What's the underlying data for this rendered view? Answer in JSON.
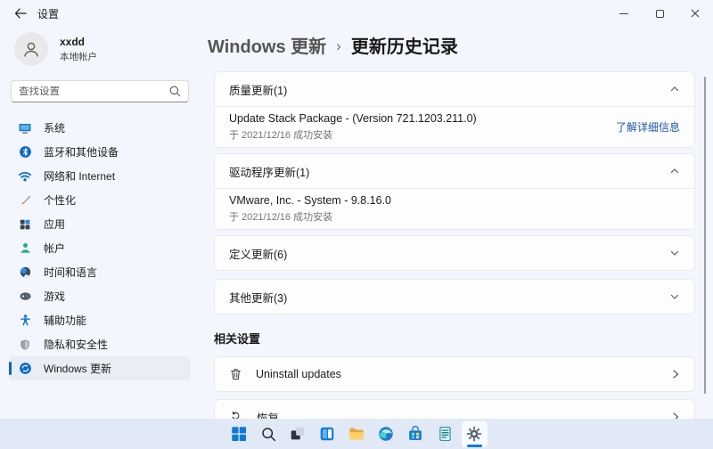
{
  "window": {
    "title": "设置"
  },
  "profile": {
    "name": "xxdd",
    "type": "本地帐户"
  },
  "search": {
    "placeholder": "查找设置"
  },
  "sidebar": {
    "items": [
      {
        "label": "系统",
        "icon": "system-icon"
      },
      {
        "label": "蓝牙和其他设备",
        "icon": "bluetooth-icon"
      },
      {
        "label": "网络和 Internet",
        "icon": "network-icon"
      },
      {
        "label": "个性化",
        "icon": "personalization-icon"
      },
      {
        "label": "应用",
        "icon": "apps-icon"
      },
      {
        "label": "帐户",
        "icon": "accounts-icon"
      },
      {
        "label": "时间和语言",
        "icon": "time-language-icon"
      },
      {
        "label": "游戏",
        "icon": "gaming-icon"
      },
      {
        "label": "辅助功能",
        "icon": "accessibility-icon"
      },
      {
        "label": "隐私和安全性",
        "icon": "privacy-icon"
      },
      {
        "label": "Windows 更新",
        "icon": "windows-update-icon"
      }
    ],
    "selected": "Windows 更新"
  },
  "header": {
    "breadcrumb_root": "Windows 更新",
    "separator": "›",
    "breadcrumb_current": "更新历史记录"
  },
  "sections": {
    "quality": {
      "label": "质量更新(1)",
      "expanded": true,
      "item_title": "Update Stack Package - (Version 721.1203.211.0)",
      "item_subtitle": "于 2021/12/16 成功安装",
      "item_link": "了解详细信息"
    },
    "driver": {
      "label": "驱动程序更新(1)",
      "expanded": true,
      "item_title": "VMware, Inc. - System - 9.8.16.0",
      "item_subtitle": "于 2021/12/16 成功安装"
    },
    "definition": {
      "label": "定义更新(6)",
      "expanded": false
    },
    "other": {
      "label": "其他更新(3)",
      "expanded": false
    }
  },
  "related": {
    "heading": "相关设置",
    "uninstall_label": "Uninstall updates",
    "recovery_label": "恢复"
  },
  "taskbar": {
    "icons": [
      "start",
      "search",
      "task-view",
      "widgets",
      "file-explorer",
      "edge",
      "store",
      "journal",
      "settings"
    ],
    "active": "settings"
  },
  "colors": {
    "accent": "#0067c0",
    "link": "#1d57a8",
    "page_bg": "#f3f6fc",
    "card_bg": "#fdfdfd",
    "taskbar_bg": "#e0e9f5"
  }
}
